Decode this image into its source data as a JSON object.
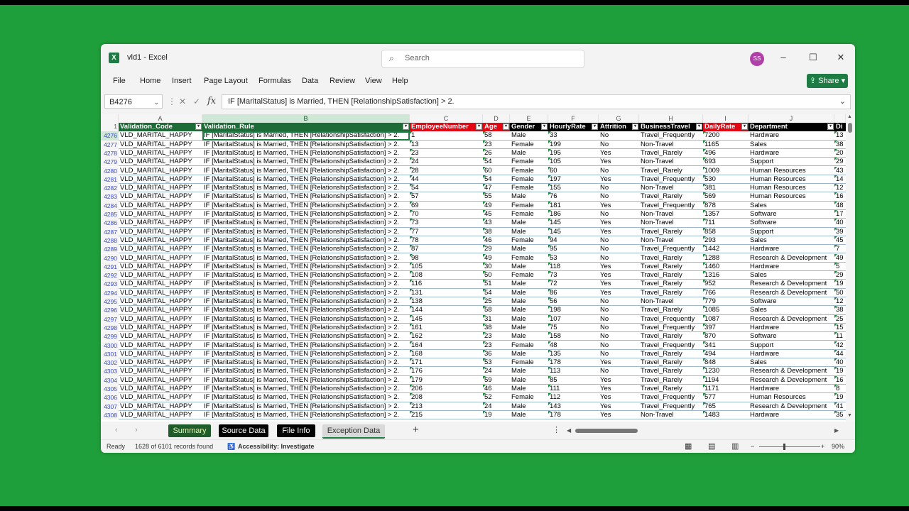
{
  "app": {
    "title": "vld1 - Excel",
    "logo": "X"
  },
  "search": {
    "placeholder": "Search"
  },
  "user": {
    "initials": "SS"
  },
  "menu": [
    "File",
    "Home",
    "Insert",
    "Page Layout",
    "Formulas",
    "Data",
    "Review",
    "View",
    "Help"
  ],
  "share_label": "Share",
  "formula_bar": {
    "cell_ref": "B4276",
    "fx": "fx",
    "formula": "IF [MaritalStatus] is Married, THEN [RelationshipSatisfaction] > 2."
  },
  "col_letters": [
    "A",
    "B",
    "C",
    "D",
    "E",
    "F",
    "G",
    "H",
    "I",
    "J"
  ],
  "header_row_num": "1",
  "headers": [
    "Validation_Code",
    "Validation_Rule",
    "EmployeeNumber",
    "Age",
    "Gender",
    "HourlyRate",
    "Attrition",
    "BusinessTravel",
    "DailyRate",
    "Department",
    "Di"
  ],
  "validation_code": "VLD_MARITAL_HAPPY",
  "validation_rule": "IF [MaritalStatus] is Married, THEN [RelationshipSatisfaction] > 2.",
  "rows": [
    [
      "4276",
      "1",
      "58",
      "Male",
      "33",
      "No",
      "Travel_Frequently",
      "7200",
      "Hardware",
      "13"
    ],
    [
      "4277",
      "13",
      "23",
      "Female",
      "199",
      "No",
      "Non-Travel",
      "1165",
      "Sales",
      "38"
    ],
    [
      "4278",
      "23",
      "26",
      "Male",
      "195",
      "Yes",
      "Travel_Rarely",
      "496",
      "Hardware",
      "20"
    ],
    [
      "4279",
      "24",
      "54",
      "Female",
      "105",
      "Yes",
      "Non-Travel",
      "693",
      "Support",
      "29"
    ],
    [
      "4280",
      "28",
      "60",
      "Female",
      "60",
      "No",
      "Travel_Rarely",
      "1009",
      "Human Resources",
      "43"
    ],
    [
      "4281",
      "44",
      "54",
      "Female",
      "197",
      "Yes",
      "Travel_Frequently",
      "530",
      "Human Resources",
      "14"
    ],
    [
      "4282",
      "54",
      "47",
      "Female",
      "155",
      "No",
      "Non-Travel",
      "381",
      "Human Resources",
      "12"
    ],
    [
      "4283",
      "57",
      "55",
      "Male",
      "76",
      "No",
      "Travel_Rarely",
      "569",
      "Human Resources",
      "16"
    ],
    [
      "4284",
      "69",
      "49",
      "Female",
      "181",
      "Yes",
      "Travel_Frequently",
      "878",
      "Sales",
      "48"
    ],
    [
      "4285",
      "70",
      "45",
      "Female",
      "186",
      "No",
      "Non-Travel",
      "1357",
      "Software",
      "17"
    ],
    [
      "4286",
      "73",
      "43",
      "Male",
      "145",
      "Yes",
      "Non-Travel",
      "711",
      "Software",
      "40"
    ],
    [
      "4287",
      "77",
      "38",
      "Male",
      "145",
      "Yes",
      "Travel_Rarely",
      "858",
      "Support",
      "39"
    ],
    [
      "4288",
      "78",
      "46",
      "Female",
      "94",
      "No",
      "Non-Travel",
      "293",
      "Sales",
      "45"
    ],
    [
      "4289",
      "87",
      "29",
      "Male",
      "95",
      "No",
      "Travel_Frequently",
      "1442",
      "Hardware",
      "7"
    ],
    [
      "4290",
      "98",
      "49",
      "Female",
      "53",
      "No",
      "Travel_Rarely",
      "1288",
      "Research & Development",
      "49"
    ],
    [
      "4291",
      "105",
      "30",
      "Male",
      "118",
      "Yes",
      "Travel_Rarely",
      "1460",
      "Hardware",
      "5"
    ],
    [
      "4292",
      "108",
      "50",
      "Female",
      "73",
      "Yes",
      "Travel_Rarely",
      "1316",
      "Sales",
      "29"
    ],
    [
      "4293",
      "116",
      "51",
      "Male",
      "72",
      "Yes",
      "Travel_Rarely",
      "952",
      "Research & Development",
      "19"
    ],
    [
      "4294",
      "131",
      "54",
      "Male",
      "86",
      "Yes",
      "Travel_Rarely",
      "766",
      "Research & Development",
      "50"
    ],
    [
      "4295",
      "138",
      "25",
      "Male",
      "56",
      "No",
      "Non-Travel",
      "779",
      "Software",
      "12"
    ],
    [
      "4296",
      "144",
      "58",
      "Male",
      "198",
      "No",
      "Travel_Rarely",
      "1085",
      "Sales",
      "38"
    ],
    [
      "4297",
      "145",
      "31",
      "Male",
      "107",
      "No",
      "Travel_Frequently",
      "1087",
      "Research & Development",
      "25"
    ],
    [
      "4298",
      "161",
      "38",
      "Male",
      "75",
      "No",
      "Travel_Frequently",
      "397",
      "Hardware",
      "15"
    ],
    [
      "4299",
      "162",
      "23",
      "Male",
      "158",
      "No",
      "Travel_Rarely",
      "870",
      "Software",
      "11"
    ],
    [
      "4300",
      "164",
      "23",
      "Female",
      "48",
      "No",
      "Travel_Frequently",
      "341",
      "Support",
      "42"
    ],
    [
      "4301",
      "168",
      "36",
      "Male",
      "135",
      "No",
      "Travel_Rarely",
      "494",
      "Hardware",
      "44"
    ],
    [
      "4302",
      "171",
      "53",
      "Female",
      "178",
      "Yes",
      "Travel_Rarely",
      "848",
      "Sales",
      "40"
    ],
    [
      "4303",
      "176",
      "24",
      "Male",
      "113",
      "No",
      "Travel_Rarely",
      "1230",
      "Research & Development",
      "19"
    ],
    [
      "4304",
      "179",
      "59",
      "Male",
      "85",
      "Yes",
      "Travel_Rarely",
      "1194",
      "Research & Development",
      "16"
    ],
    [
      "4305",
      "206",
      "46",
      "Male",
      "111",
      "Yes",
      "Travel_Rarely",
      "1171",
      "Hardware",
      "8"
    ],
    [
      "4306",
      "208",
      "52",
      "Female",
      "112",
      "Yes",
      "Travel_Frequently",
      "577",
      "Human Resources",
      "19"
    ],
    [
      "4307",
      "213",
      "24",
      "Male",
      "143",
      "Yes",
      "Travel_Frequently",
      "765",
      "Research & Development",
      "41"
    ],
    [
      "4308",
      "215",
      "19",
      "Male",
      "178",
      "Yes",
      "Non-Travel",
      "1483",
      "Hardware",
      "35"
    ]
  ],
  "sheets": [
    "Summary",
    "Source Data",
    "File Info",
    "Exception Data"
  ],
  "add_sheet": "+",
  "status": {
    "ready": "Ready",
    "records": "1628 of 6101 records found",
    "accessibility": "Accessibility: Investigate",
    "zoom": "90%"
  },
  "colors": {
    "background": "#1f9f3b",
    "excel_green": "#1e7b43",
    "header_green": "#1d6b36",
    "header_red": "#e30613",
    "header_black": "#000000"
  }
}
